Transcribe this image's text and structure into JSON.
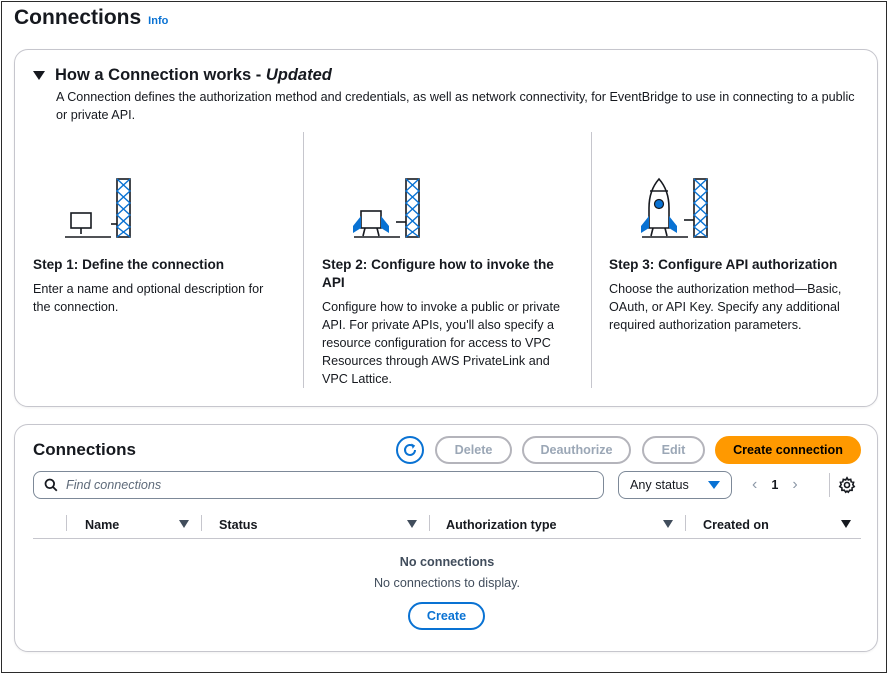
{
  "page": {
    "title": "Connections",
    "info_link": "Info"
  },
  "how_it_works": {
    "title_prefix": "How a Connection works - ",
    "title_emphasis": "Updated",
    "description": "A Connection defines the authorization method and credentials, as well as network connectivity, for EventBridge to use in connecting to a public or private API.",
    "steps": [
      {
        "title": "Step 1: Define the connection",
        "text": "Enter a name and optional description for the connection.",
        "icon": "monitor-tower-icon"
      },
      {
        "title": "Step 2: Configure how to invoke the API",
        "text": "Configure how to invoke a public or private API. For private APIs, you'll also specify a resource configuration for access to VPC Resources through AWS PrivateLink and VPC Lattice.",
        "icon": "winged-module-tower-icon"
      },
      {
        "title": "Step 3: Configure API authorization",
        "text": "Choose the authorization method—Basic, OAuth, or API Key. Specify any additional required authorization parameters.",
        "icon": "rocket-tower-icon"
      }
    ]
  },
  "connections": {
    "title": "Connections",
    "buttons": {
      "refresh_icon": "refresh-icon",
      "delete": "Delete",
      "deauthorize": "Deauthorize",
      "edit": "Edit",
      "create_connection": "Create connection"
    },
    "search": {
      "placeholder": "Find connections",
      "value": ""
    },
    "status_filter": {
      "selected": "Any status"
    },
    "pagination": {
      "current_page": "1"
    },
    "columns": [
      "Name",
      "Status",
      "Authorization type",
      "Created on"
    ],
    "empty": {
      "title": "No connections",
      "text": "No connections to display.",
      "button": "Create"
    }
  },
  "colors": {
    "accent": "#0972d3",
    "primary_button": "#ff9900",
    "illustration_blue": "#0972d3"
  }
}
